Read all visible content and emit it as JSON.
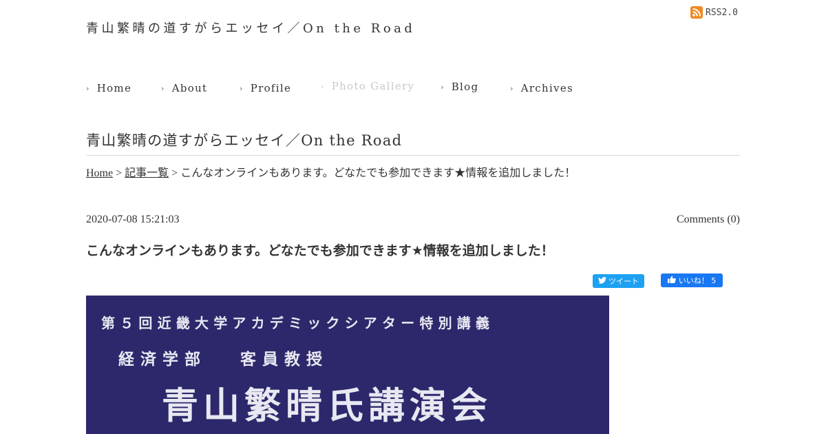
{
  "site": {
    "title": "青山繁晴の道すがらエッセイ／On the Road",
    "rss_label": "RSS2.0"
  },
  "nav": {
    "items": [
      {
        "label": "Home"
      },
      {
        "label": "About"
      },
      {
        "label": "Profile"
      },
      {
        "label": "Photo Gallery"
      },
      {
        "label": "Blog"
      },
      {
        "label": "Archives"
      }
    ]
  },
  "page": {
    "title": "青山繁晴の道すがらエッセイ／On the Road"
  },
  "breadcrumb": {
    "home": "Home",
    "separator": ">",
    "list": "記事一覧",
    "current": "こんなオンラインもあります。どなたでも参加できます★情報を追加しました！"
  },
  "post": {
    "date": "2020-07-08 15:21:03",
    "comments": "Comments (0)",
    "title": "こんなオンラインもあります。どなたでも参加できます★情報を追加しました！"
  },
  "social": {
    "tweet_label": "ツイート",
    "like_label": "いいね！ 5"
  },
  "banner": {
    "line1": "第５回近畿大学アカデミックシアター特別講義",
    "line2": "経済学部　 客員教授",
    "line3": "青山繁晴氏講演会",
    "background": "#2d286b"
  },
  "colors": {
    "text": "#333333",
    "rss": "#f08a24",
    "twitter": "#1da1f2",
    "facebook": "#1877f2"
  }
}
